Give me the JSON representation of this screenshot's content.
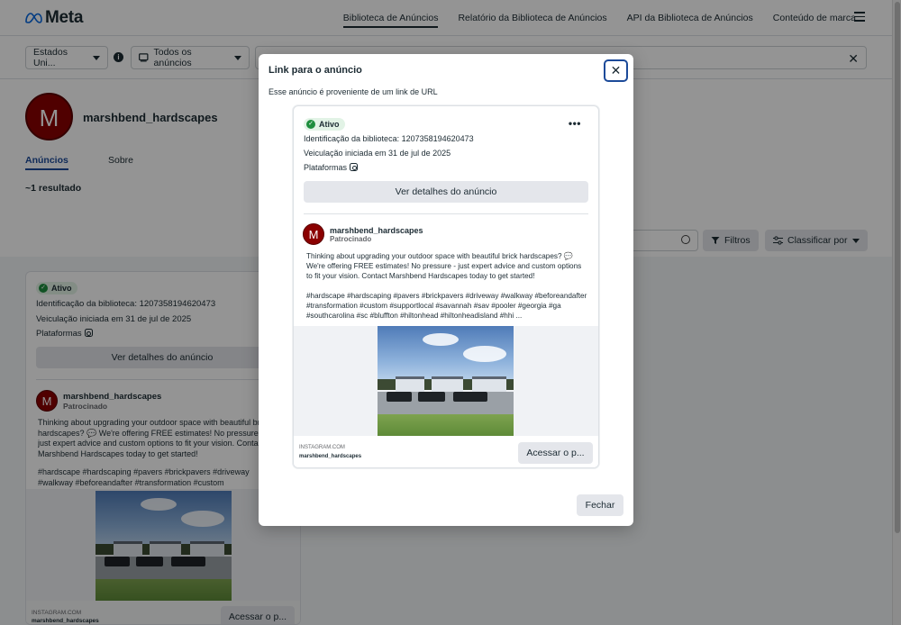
{
  "brand": {
    "name": "Meta"
  },
  "topnav": [
    {
      "label": "Biblioteca de Anúncios",
      "active": true
    },
    {
      "label": "Relatório da Biblioteca de Anúncios",
      "active": false
    },
    {
      "label": "API da Biblioteca de Anúncios",
      "active": false
    },
    {
      "label": "Conteúdo de marca",
      "active": false
    }
  ],
  "filters": {
    "country": "Estados Uni...",
    "ad_type": "Todos os anúncios"
  },
  "profile": {
    "initial": "M",
    "name": "marshbend_hardscapes",
    "tabs": [
      "Anúncios",
      "Sobre"
    ],
    "result_count": "~1 resultado"
  },
  "toolbar": {
    "filters_label": "Filtros",
    "sort_label": "Classificar por"
  },
  "ad": {
    "status": "Ativo",
    "library_id": "Identificação da biblioteca: 1207358194620473",
    "started": "Veiculação iniciada em 31 de jul de 2025",
    "platforms_label": "Plataformas",
    "details_button": "Ver detalhes do anúncio",
    "advertiser": "marshbend_hardscapes",
    "sponsored": "Patrocinado",
    "body": "Thinking about upgrading your outdoor space with beautiful brick hardscapes? 💬 We're offering FREE estimates! No pressure - just expert advice and custom options to fit your vision. Contact Marshbend Hardscapes today to get started!",
    "hashtags": "#hardscape #hardscaping #pavers #brickpavers #driveway #walkway #beforeandafter #transformation #custom #supportlocal #savannah #sav #pooler #georgia #ga #southcarolina #sc #bluffton #hiltonhead #hiltonheadisland #hhi ...",
    "bg_body": "Thinking about upgrading your outdoor space with beautiful brick hardscapes? 💬 We're offering FREE estimates! No pressure - just expert advice and custom options to fit your vision. Contact Marshbend Hardscapes today to get started!",
    "bg_hashtags": "#hardscape #hardscaping #pavers #brickpavers #driveway #walkway #beforeandafter #transformation #custom #supportlocal #savannah",
    "cta_domain": "INSTAGRAM.COM",
    "cta_name": "marshbend_hardscapes",
    "cta_button": "Acessar o p..."
  },
  "modal": {
    "title": "Link para o anúncio",
    "subtitle": "Esse anúncio é proveniente de um link de URL",
    "close_icon": "close-icon",
    "more_icon": "•••",
    "close_button": "Fechar"
  }
}
